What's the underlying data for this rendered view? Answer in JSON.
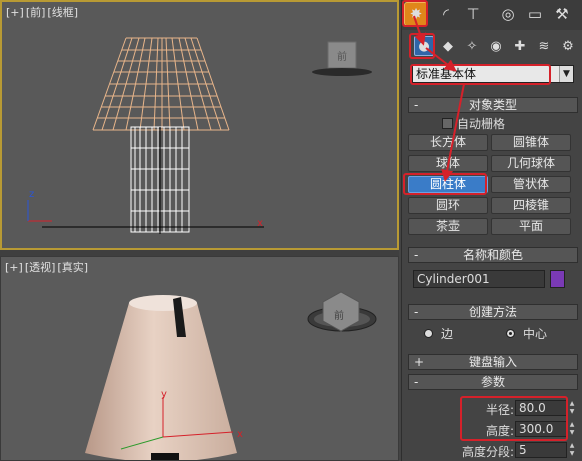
{
  "viewports": {
    "top": {
      "label_a": "[+]",
      "label_b": "[前]",
      "label_c": "[线框]",
      "view_cube_text": "前"
    },
    "bottom": {
      "label_a": "[+]",
      "label_b": "[透视]",
      "label_c": "[真实]",
      "view_cube_text": "前"
    }
  },
  "axes": {
    "x": "x",
    "y": "y",
    "z": "z"
  },
  "panel": {
    "tabs": [
      "create-icon",
      "modify-icon",
      "hierarchy-icon",
      "motion-icon",
      "display-icon",
      "utilities-icon"
    ],
    "dropdown_value": "标准基本体",
    "object_type": {
      "header": "对象类型",
      "sign": "-",
      "autogrid_label": "自动栅格",
      "buttons": [
        "长方体",
        "圆锥体",
        "球体",
        "几何球体",
        "圆柱体",
        "管状体",
        "圆环",
        "四棱锥",
        "茶壶",
        "平面"
      ]
    },
    "name_color": {
      "header": "名称和颜色",
      "sign": "-",
      "name_value": "Cylinder001",
      "color": "#7a3ab5"
    },
    "creation_method": {
      "header": "创建方法",
      "sign": "-",
      "edge_label": "边",
      "center_label": "中心"
    },
    "keyboard_entry": {
      "header": "键盘输入",
      "sign": "+"
    },
    "parameters": {
      "header": "参数",
      "sign": "-",
      "radius_label": "半径:",
      "radius_value": "80.0",
      "height_label": "高度:",
      "height_value": "300.0",
      "height_segments_label": "高度分段:",
      "height_segments_value": "5"
    }
  },
  "colors": {
    "highlight": "#d5212a",
    "active_button": "#3a7cc8",
    "wire": "#e8b58a",
    "shade": "#d8c2b4"
  }
}
